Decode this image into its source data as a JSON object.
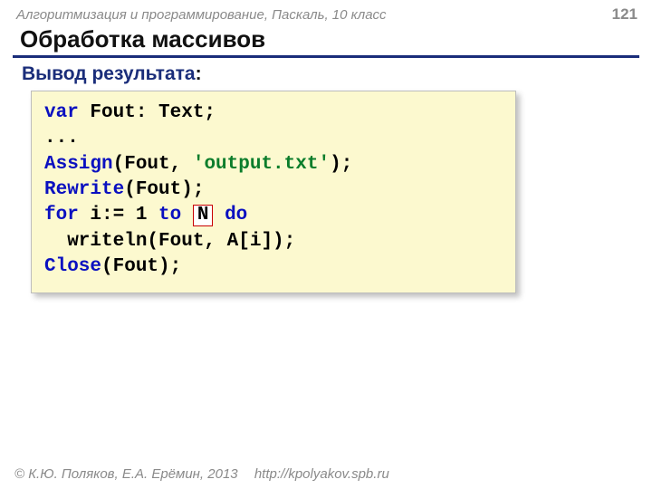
{
  "header": {
    "course": "Алгоритмизация и программирование, Паскаль, 10 класс",
    "page": "121"
  },
  "title": "Обработка массивов",
  "subtitle": "Вывод результата",
  "colon": ":",
  "code": {
    "l1_var": "var",
    "l1_rest": " Fout: Text;",
    "l2": "...",
    "l3_assign": "Assign",
    "l3_open": "(Fout, ",
    "l3_str": "'output.txt'",
    "l3_close": ");",
    "l4_rewrite": "Rewrite",
    "l4_rest": "(Fout);",
    "l5_for": "for",
    "l5_mid1": " i:= 1 ",
    "l5_to": "to",
    "l5_sp": " ",
    "l5_N": "N",
    "l5_do": "do",
    "l6": "  writeln(Fout, A[i]);",
    "l7_close": "Close",
    "l7_rest": "(Fout);"
  },
  "footer": {
    "copyright": "© К.Ю. Поляков, Е.А. Ерёмин, 2013",
    "url": "http://kpolyakov.spb.ru"
  }
}
